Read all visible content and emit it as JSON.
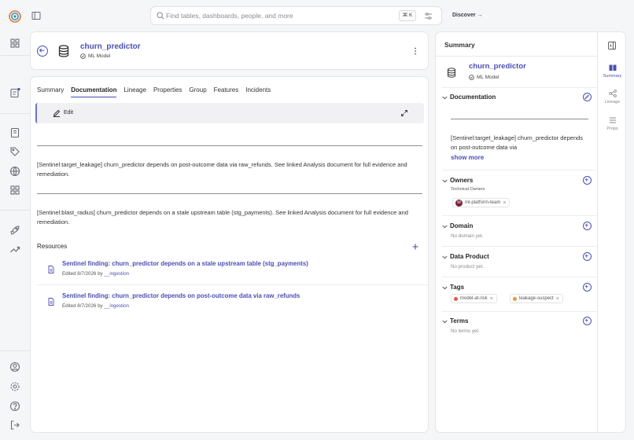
{
  "search": {
    "placeholder": "Find tables, dashboards, people, and more",
    "shortcut": "⌘ K"
  },
  "topbar": {
    "discover_label": "Discover →"
  },
  "colors": {
    "accent": "#4b4fb4",
    "danger_dot": "#e05a47",
    "warning_dot": "#e69a3a"
  },
  "entity": {
    "name": "churn_predictor",
    "type": "ML Model"
  },
  "tabs": [
    {
      "label": "Summary"
    },
    {
      "label": "Documentation"
    },
    {
      "label": "Lineage"
    },
    {
      "label": "Properties"
    },
    {
      "label": "Group"
    },
    {
      "label": "Features"
    },
    {
      "label": "Incidents"
    }
  ],
  "active_tab": "Documentation",
  "documentation": {
    "edit_label": "Edit",
    "paragraphs": [
      "[Sentinel:target_leakage] churn_predictor depends on post-outcome data via raw_refunds. See linked Analysis document for full evidence and remediation.",
      "[Sentinel:blast_radius] churn_predictor depends on a stale upstream table (stg_payments). See linked Analysis document for full evidence and remediation."
    ]
  },
  "resources": {
    "title": "Resources",
    "items": [
      {
        "title": "Sentinel finding: churn_predictor depends on a stale upstream table (stg_payments)",
        "edited": "Edited 8/7/2026 by",
        "user": "__ingestion"
      },
      {
        "title": "Sentinel finding: churn_predictor depends on post-outcome data via raw_refunds",
        "edited": "Edited 8/7/2026 by",
        "user": "__ingestion"
      }
    ]
  },
  "summary_panel": {
    "title": "Summary",
    "entity_name": "churn_predictor",
    "entity_type": "ML Model",
    "documentation": {
      "title": "Documentation",
      "text": "[Sentinel:target_leakage] churn_predictor depends on post-outcome data via",
      "show_more": "show more"
    },
    "owners": {
      "title": "Owners",
      "subtitle": "Technical Owners",
      "owner": "ml-platform-team",
      "avatar_letter": "M"
    },
    "domain": {
      "title": "Domain",
      "empty": "No domain yet."
    },
    "data_product": {
      "title": "Data Product",
      "empty": "No product yet."
    },
    "tags": {
      "title": "Tags",
      "items": [
        "model-at-risk",
        "leakage-suspect"
      ]
    },
    "terms": {
      "title": "Terms",
      "empty": "No terms yet."
    }
  },
  "right_nav": [
    {
      "label": "Summary",
      "icon": "summary-icon"
    },
    {
      "label": "Lineage",
      "icon": "lineage-icon"
    },
    {
      "label": "Props",
      "icon": "properties-icon"
    }
  ]
}
